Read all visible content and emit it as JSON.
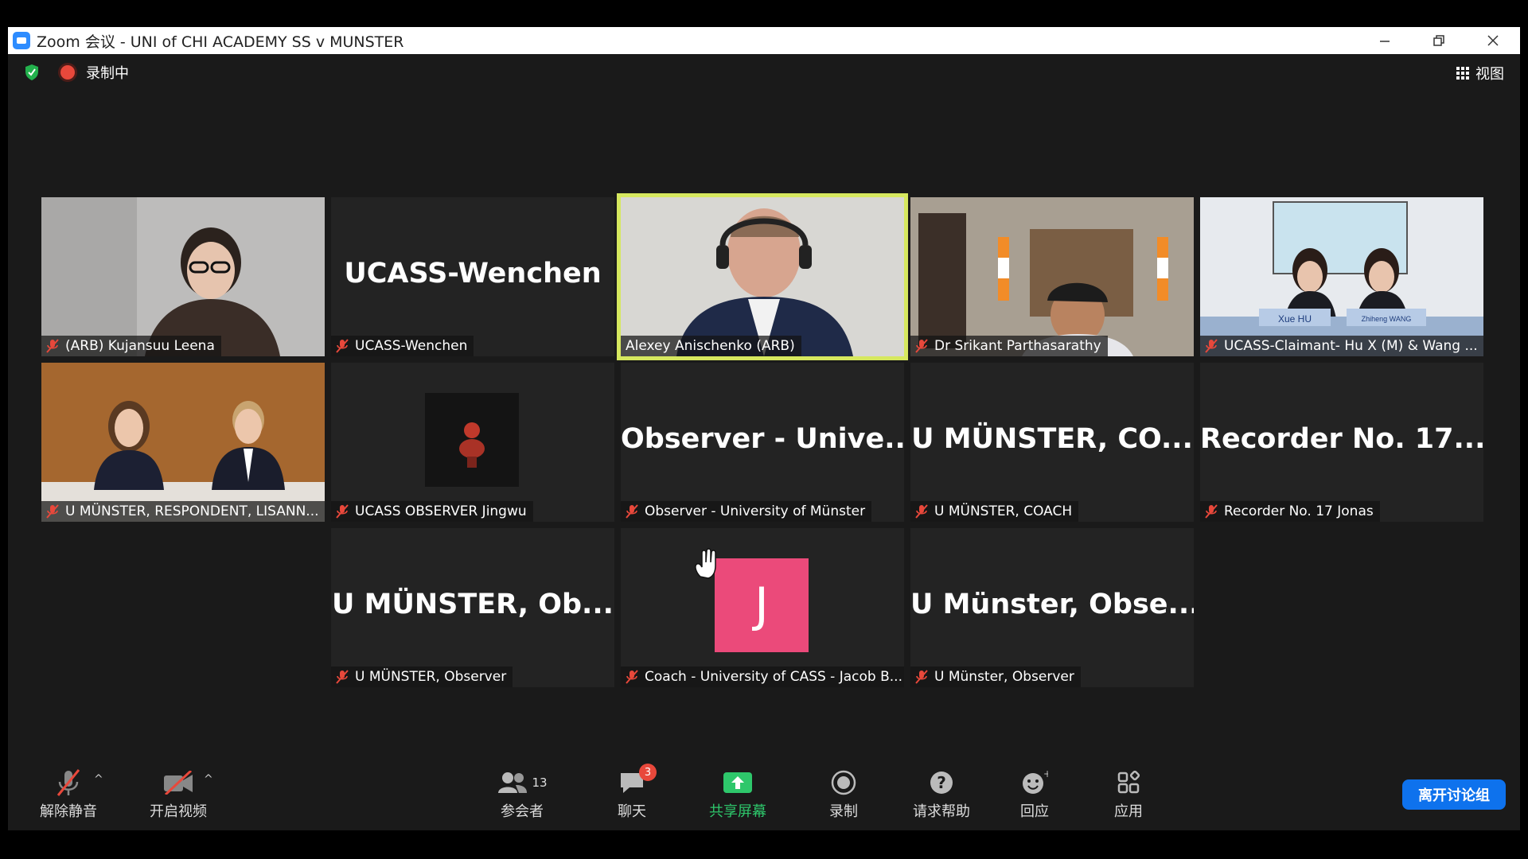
{
  "window": {
    "title": "Zoom 会议 - UNI of CHI ACADEMY SS v MUNSTER"
  },
  "status": {
    "recording_label": "录制中",
    "view_label": "视图"
  },
  "tiles": [
    {
      "big": "",
      "label": "(ARB) Kujansuu Leena"
    },
    {
      "big": "UCASS-Wenchen",
      "label": "UCASS-Wenchen"
    },
    {
      "big": "",
      "label": "Alexey Anischenko (ARB)"
    },
    {
      "big": "",
      "label": "Dr Srikant Parthasarathy"
    },
    {
      "big": "",
      "label": "UCASS-Claimant- Hu X (M) & Wang ...",
      "nameplates": [
        "Xue HU",
        "Zhiheng WANG"
      ]
    },
    {
      "big": "",
      "label": "U MÜNSTER, RESPONDENT, LISANN..."
    },
    {
      "big": "",
      "label": "UCASS OBSERVER Jingwu"
    },
    {
      "big": "Observer - Unive...",
      "label": "Observer - University of Münster"
    },
    {
      "big": "U MÜNSTER, CO...",
      "label": "U MÜNSTER, COACH"
    },
    {
      "big": "Recorder No. 17...",
      "label": "Recorder No. 17 Jonas"
    },
    {
      "big": "U MÜNSTER, Ob...",
      "label": "U MÜNSTER, Observer"
    },
    {
      "big": "J",
      "label": "Coach - University of CASS - Jacob B..."
    },
    {
      "big": "U Münster, Obse...",
      "label": "U Münster, Observer"
    }
  ],
  "toolbar": {
    "unmute": "解除静音",
    "start_video": "开启视频",
    "participants": "参会者",
    "participants_count": "13",
    "chat": "聊天",
    "chat_badge": "3",
    "share": "共享屏幕",
    "record": "录制",
    "ask_help": "请求帮助",
    "reactions": "回应",
    "apps": "应用",
    "leave_room": "离开讨论组"
  },
  "colors": {
    "active_speaker": "#d6e85f",
    "avatar_j": "#eb4a7a",
    "leave_button": "#0e72ed",
    "share": "#2ec76b",
    "muted_icon": "#e8483b"
  }
}
